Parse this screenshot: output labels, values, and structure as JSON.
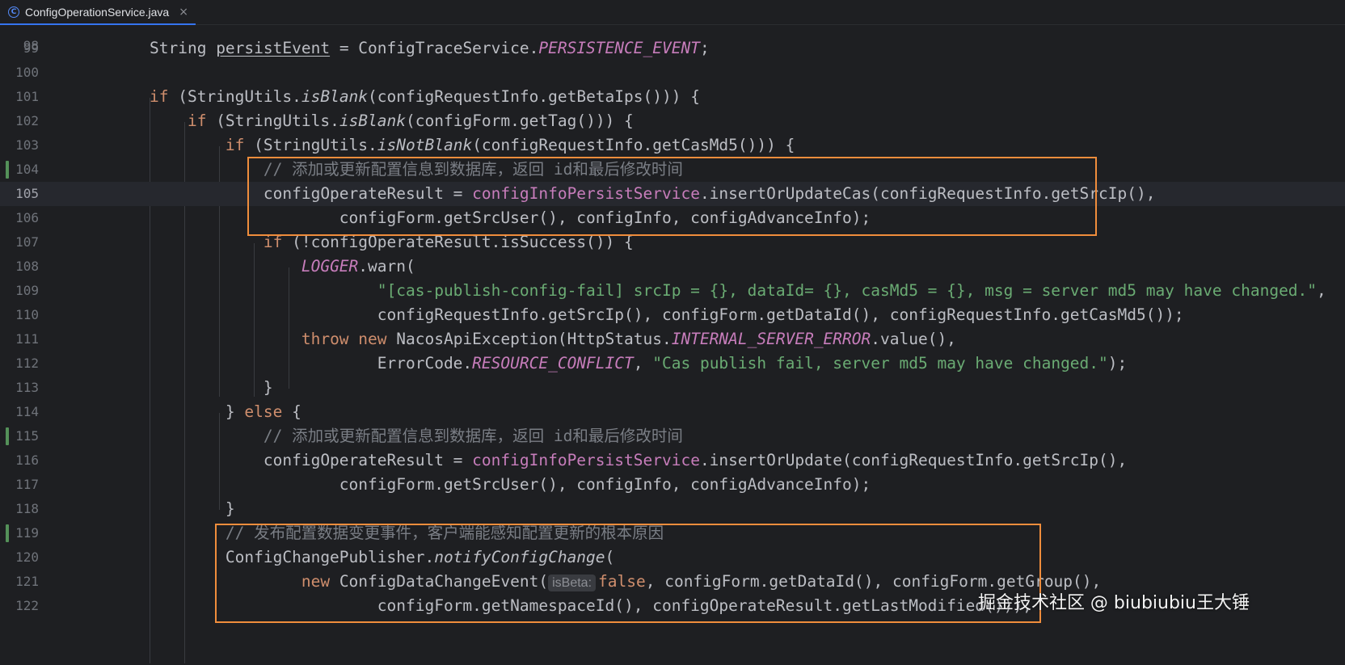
{
  "tab": {
    "icon": "class-icon",
    "icon_glyph": "C",
    "label": "ConfigOperationService.java",
    "close": "×"
  },
  "lines": [
    {
      "num": "99",
      "segs": [
        {
          "t": "String "
        },
        {
          "t": "persistEvent",
          "c": "ul"
        },
        {
          "t": " = ConfigTraceService."
        },
        {
          "t": "PERSISTENCE_EVENT",
          "c": "fld it"
        },
        {
          "t": ";"
        }
      ]
    },
    {
      "num": "100",
      "segs": []
    },
    {
      "num": "101",
      "segs": [
        {
          "t": "if",
          "c": "kw"
        },
        {
          "t": " (StringUtils."
        },
        {
          "t": "isBlank",
          "c": "it"
        },
        {
          "t": "(configRequestInfo.getBetaIps())) {"
        }
      ]
    },
    {
      "num": "102",
      "segs": [
        {
          "t": "    "
        },
        {
          "t": "if",
          "c": "kw"
        },
        {
          "t": " (StringUtils."
        },
        {
          "t": "isBlank",
          "c": "it"
        },
        {
          "t": "(configForm.getTag())) {"
        }
      ]
    },
    {
      "num": "103",
      "segs": [
        {
          "t": "        "
        },
        {
          "t": "if",
          "c": "kw"
        },
        {
          "t": " (StringUtils."
        },
        {
          "t": "isNotBlank",
          "c": "it"
        },
        {
          "t": "(configRequestInfo.getCasMd5())) {"
        }
      ]
    },
    {
      "num": "104",
      "vcs": true,
      "segs": [
        {
          "t": "            "
        },
        {
          "t": "// ",
          "c": "cmt"
        },
        {
          "t": "添加或更新配置信息到数据库，返回",
          "c": "cmt cjk"
        },
        {
          "t": " id",
          "c": "cmt"
        },
        {
          "t": "和最后修改时间",
          "c": "cmt cjk"
        }
      ]
    },
    {
      "num": "105",
      "current": true,
      "segs": [
        {
          "t": "            configOperateResult = "
        },
        {
          "t": "configInfoPersistService",
          "c": "fld"
        },
        {
          "t": ".insertOrUpdateCas(configRequestInfo.getSrcIp(),"
        }
      ]
    },
    {
      "num": "106",
      "segs": [
        {
          "t": "                    configForm.getSrcUser(), configInfo, configAdvanceInfo);"
        }
      ]
    },
    {
      "num": "107",
      "segs": [
        {
          "t": "            "
        },
        {
          "t": "if",
          "c": "kw"
        },
        {
          "t": " (!configOperateResult.isSuccess()) {"
        }
      ]
    },
    {
      "num": "108",
      "segs": [
        {
          "t": "                "
        },
        {
          "t": "LOGGER",
          "c": "fld it"
        },
        {
          "t": ".warn("
        }
      ]
    },
    {
      "num": "109",
      "segs": [
        {
          "t": "                        "
        },
        {
          "t": "\"[cas-publish-config-fail] srcIp = {}, dataId= {}, casMd5 = {}, msg = server md5 may have changed.\"",
          "c": "str"
        },
        {
          "t": ","
        }
      ]
    },
    {
      "num": "110",
      "segs": [
        {
          "t": "                        configRequestInfo.getSrcIp(), configForm.getDataId(), configRequestInfo.getCasMd5());"
        }
      ]
    },
    {
      "num": "111",
      "segs": [
        {
          "t": "                "
        },
        {
          "t": "throw new",
          "c": "kw"
        },
        {
          "t": " NacosApiException(HttpStatus."
        },
        {
          "t": "INTERNAL_SERVER_ERROR",
          "c": "fld it"
        },
        {
          "t": ".value(),"
        }
      ]
    },
    {
      "num": "112",
      "segs": [
        {
          "t": "                        ErrorCode."
        },
        {
          "t": "RESOURCE_CONFLICT",
          "c": "fld it"
        },
        {
          "t": ", "
        },
        {
          "t": "\"Cas publish fail, server md5 may have changed.\"",
          "c": "str"
        },
        {
          "t": ");"
        }
      ]
    },
    {
      "num": "113",
      "segs": [
        {
          "t": "            }"
        }
      ]
    },
    {
      "num": "114",
      "segs": [
        {
          "t": "        } "
        },
        {
          "t": "else",
          "c": "kw"
        },
        {
          "t": " {"
        }
      ]
    },
    {
      "num": "115",
      "vcs": true,
      "segs": [
        {
          "t": "            "
        },
        {
          "t": "// ",
          "c": "cmt"
        },
        {
          "t": "添加或更新配置信息到数据库，返回",
          "c": "cmt cjk"
        },
        {
          "t": " id",
          "c": "cmt"
        },
        {
          "t": "和最后修改时间",
          "c": "cmt cjk"
        }
      ]
    },
    {
      "num": "116",
      "segs": [
        {
          "t": "            configOperateResult = "
        },
        {
          "t": "configInfoPersistService",
          "c": "fld"
        },
        {
          "t": ".insertOrUpdate(configRequestInfo.getSrcIp(),"
        }
      ]
    },
    {
      "num": "117",
      "segs": [
        {
          "t": "                    configForm.getSrcUser(), configInfo, configAdvanceInfo);"
        }
      ]
    },
    {
      "num": "118",
      "segs": [
        {
          "t": "        }"
        }
      ]
    },
    {
      "num": "119",
      "vcs": true,
      "segs": [
        {
          "t": "        "
        },
        {
          "t": "// ",
          "c": "cmt"
        },
        {
          "t": "发布配置数据变更事件，客户端能感知配置更新的根本原因",
          "c": "cmt cjk"
        }
      ]
    },
    {
      "num": "120",
      "segs": [
        {
          "t": "        ConfigChangePublisher."
        },
        {
          "t": "notifyConfigChange",
          "c": "it"
        },
        {
          "t": "("
        }
      ]
    },
    {
      "num": "121",
      "segs": [
        {
          "t": "                "
        },
        {
          "t": "new",
          "c": "kw"
        },
        {
          "t": " ConfigDataChangeEvent("
        },
        {
          "t": "isBeta:",
          "c": "hint"
        },
        {
          "t": "false",
          "c": "kw"
        },
        {
          "t": ", configForm.getDataId(), configForm.getGroup(),"
        }
      ]
    },
    {
      "num": "122",
      "segs": [
        {
          "t": "                        configForm.getNamespaceId(), configOperateResult.getLastModified()));"
        }
      ]
    }
  ],
  "watermark": "掘金技术社区 @ biubiubiu王大锤",
  "colors": {
    "keyword": "#cf8e6d",
    "string": "#6aab73",
    "field": "#c77dbb",
    "comment": "#7a7e85",
    "highlight_box": "#f08d3c",
    "vcs_added": "#549159"
  }
}
